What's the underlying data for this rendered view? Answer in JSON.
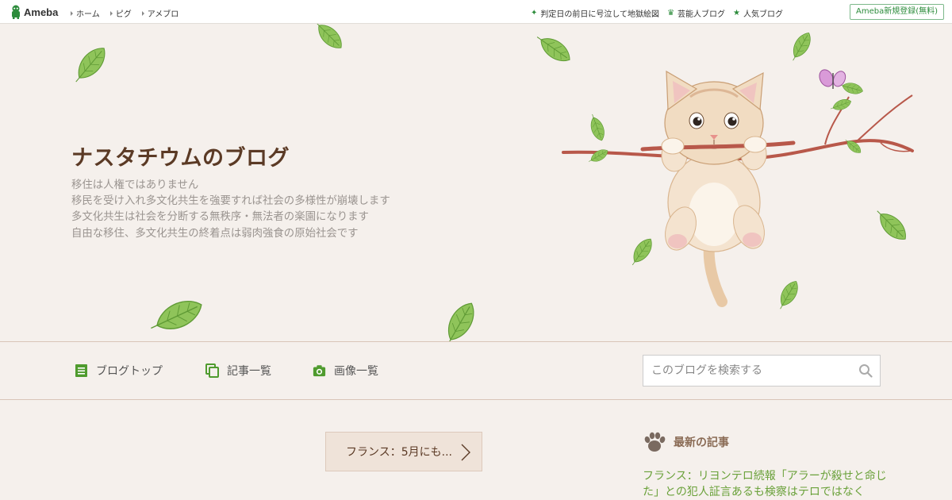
{
  "topbar": {
    "logo_text": "Ameba",
    "crumbs": [
      "ホーム",
      "ピグ",
      "アメブロ"
    ],
    "links": [
      {
        "icon": "sparkle-icon",
        "label": "判定日の前日に号泣して地獄絵図"
      },
      {
        "icon": "crown-icon",
        "label": "芸能人ブログ"
      },
      {
        "icon": "star-icon",
        "label": "人気ブログ"
      }
    ],
    "signup_label": "Ameba新規登録(無料)"
  },
  "header": {
    "title": "ナスタチウムのブログ",
    "description": [
      "移住は人権ではありません",
      "移民を受け入れ多文化共生を強要すれば社会の多様性が崩壊します",
      "多文化共生は社会を分断する無秩序・無法者の楽園になります",
      "自由な移住、多文化共生の終着点は弱肉強食の原始社会です"
    ]
  },
  "nav": {
    "items": [
      {
        "icon": "document-icon",
        "label": "ブログトップ"
      },
      {
        "icon": "copy-icon",
        "label": "記事一覧"
      },
      {
        "icon": "camera-icon",
        "label": "画像一覧"
      }
    ],
    "search_placeholder": "このブログを検索する"
  },
  "content": {
    "pager_label": "フランス：5月にも..."
  },
  "sidebar": {
    "heading": "最新の記事",
    "latest_article": "フランス：リヨンテロ続報「アラーが殺せと命じた」との犯人証言あるも検察はテロではなく"
  },
  "colors": {
    "accent_green": "#2d8c3c",
    "title_brown": "#5b3a25",
    "link_green": "#6aa13a",
    "background": "#f5f0ec"
  }
}
